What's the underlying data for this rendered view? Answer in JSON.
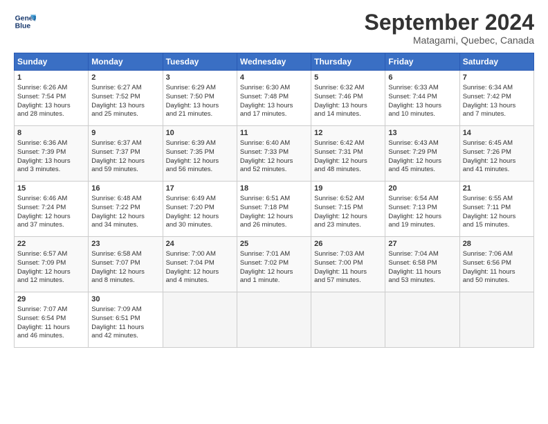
{
  "header": {
    "logo_line1": "General",
    "logo_line2": "Blue",
    "month": "September 2024",
    "location": "Matagami, Quebec, Canada"
  },
  "weekdays": [
    "Sunday",
    "Monday",
    "Tuesday",
    "Wednesday",
    "Thursday",
    "Friday",
    "Saturday"
  ],
  "weeks": [
    [
      {
        "day": "1",
        "lines": [
          "Sunrise: 6:26 AM",
          "Sunset: 7:54 PM",
          "Daylight: 13 hours",
          "and 28 minutes."
        ]
      },
      {
        "day": "2",
        "lines": [
          "Sunrise: 6:27 AM",
          "Sunset: 7:52 PM",
          "Daylight: 13 hours",
          "and 25 minutes."
        ]
      },
      {
        "day": "3",
        "lines": [
          "Sunrise: 6:29 AM",
          "Sunset: 7:50 PM",
          "Daylight: 13 hours",
          "and 21 minutes."
        ]
      },
      {
        "day": "4",
        "lines": [
          "Sunrise: 6:30 AM",
          "Sunset: 7:48 PM",
          "Daylight: 13 hours",
          "and 17 minutes."
        ]
      },
      {
        "day": "5",
        "lines": [
          "Sunrise: 6:32 AM",
          "Sunset: 7:46 PM",
          "Daylight: 13 hours",
          "and 14 minutes."
        ]
      },
      {
        "day": "6",
        "lines": [
          "Sunrise: 6:33 AM",
          "Sunset: 7:44 PM",
          "Daylight: 13 hours",
          "and 10 minutes."
        ]
      },
      {
        "day": "7",
        "lines": [
          "Sunrise: 6:34 AM",
          "Sunset: 7:42 PM",
          "Daylight: 13 hours",
          "and 7 minutes."
        ]
      }
    ],
    [
      {
        "day": "8",
        "lines": [
          "Sunrise: 6:36 AM",
          "Sunset: 7:39 PM",
          "Daylight: 13 hours",
          "and 3 minutes."
        ]
      },
      {
        "day": "9",
        "lines": [
          "Sunrise: 6:37 AM",
          "Sunset: 7:37 PM",
          "Daylight: 12 hours",
          "and 59 minutes."
        ]
      },
      {
        "day": "10",
        "lines": [
          "Sunrise: 6:39 AM",
          "Sunset: 7:35 PM",
          "Daylight: 12 hours",
          "and 56 minutes."
        ]
      },
      {
        "day": "11",
        "lines": [
          "Sunrise: 6:40 AM",
          "Sunset: 7:33 PM",
          "Daylight: 12 hours",
          "and 52 minutes."
        ]
      },
      {
        "day": "12",
        "lines": [
          "Sunrise: 6:42 AM",
          "Sunset: 7:31 PM",
          "Daylight: 12 hours",
          "and 48 minutes."
        ]
      },
      {
        "day": "13",
        "lines": [
          "Sunrise: 6:43 AM",
          "Sunset: 7:29 PM",
          "Daylight: 12 hours",
          "and 45 minutes."
        ]
      },
      {
        "day": "14",
        "lines": [
          "Sunrise: 6:45 AM",
          "Sunset: 7:26 PM",
          "Daylight: 12 hours",
          "and 41 minutes."
        ]
      }
    ],
    [
      {
        "day": "15",
        "lines": [
          "Sunrise: 6:46 AM",
          "Sunset: 7:24 PM",
          "Daylight: 12 hours",
          "and 37 minutes."
        ]
      },
      {
        "day": "16",
        "lines": [
          "Sunrise: 6:48 AM",
          "Sunset: 7:22 PM",
          "Daylight: 12 hours",
          "and 34 minutes."
        ]
      },
      {
        "day": "17",
        "lines": [
          "Sunrise: 6:49 AM",
          "Sunset: 7:20 PM",
          "Daylight: 12 hours",
          "and 30 minutes."
        ]
      },
      {
        "day": "18",
        "lines": [
          "Sunrise: 6:51 AM",
          "Sunset: 7:18 PM",
          "Daylight: 12 hours",
          "and 26 minutes."
        ]
      },
      {
        "day": "19",
        "lines": [
          "Sunrise: 6:52 AM",
          "Sunset: 7:15 PM",
          "Daylight: 12 hours",
          "and 23 minutes."
        ]
      },
      {
        "day": "20",
        "lines": [
          "Sunrise: 6:54 AM",
          "Sunset: 7:13 PM",
          "Daylight: 12 hours",
          "and 19 minutes."
        ]
      },
      {
        "day": "21",
        "lines": [
          "Sunrise: 6:55 AM",
          "Sunset: 7:11 PM",
          "Daylight: 12 hours",
          "and 15 minutes."
        ]
      }
    ],
    [
      {
        "day": "22",
        "lines": [
          "Sunrise: 6:57 AM",
          "Sunset: 7:09 PM",
          "Daylight: 12 hours",
          "and 12 minutes."
        ]
      },
      {
        "day": "23",
        "lines": [
          "Sunrise: 6:58 AM",
          "Sunset: 7:07 PM",
          "Daylight: 12 hours",
          "and 8 minutes."
        ]
      },
      {
        "day": "24",
        "lines": [
          "Sunrise: 7:00 AM",
          "Sunset: 7:04 PM",
          "Daylight: 12 hours",
          "and 4 minutes."
        ]
      },
      {
        "day": "25",
        "lines": [
          "Sunrise: 7:01 AM",
          "Sunset: 7:02 PM",
          "Daylight: 12 hours",
          "and 1 minute."
        ]
      },
      {
        "day": "26",
        "lines": [
          "Sunrise: 7:03 AM",
          "Sunset: 7:00 PM",
          "Daylight: 11 hours",
          "and 57 minutes."
        ]
      },
      {
        "day": "27",
        "lines": [
          "Sunrise: 7:04 AM",
          "Sunset: 6:58 PM",
          "Daylight: 11 hours",
          "and 53 minutes."
        ]
      },
      {
        "day": "28",
        "lines": [
          "Sunrise: 7:06 AM",
          "Sunset: 6:56 PM",
          "Daylight: 11 hours",
          "and 50 minutes."
        ]
      }
    ],
    [
      {
        "day": "29",
        "lines": [
          "Sunrise: 7:07 AM",
          "Sunset: 6:54 PM",
          "Daylight: 11 hours",
          "and 46 minutes."
        ]
      },
      {
        "day": "30",
        "lines": [
          "Sunrise: 7:09 AM",
          "Sunset: 6:51 PM",
          "Daylight: 11 hours",
          "and 42 minutes."
        ]
      },
      {
        "day": "",
        "lines": []
      },
      {
        "day": "",
        "lines": []
      },
      {
        "day": "",
        "lines": []
      },
      {
        "day": "",
        "lines": []
      },
      {
        "day": "",
        "lines": []
      }
    ]
  ]
}
